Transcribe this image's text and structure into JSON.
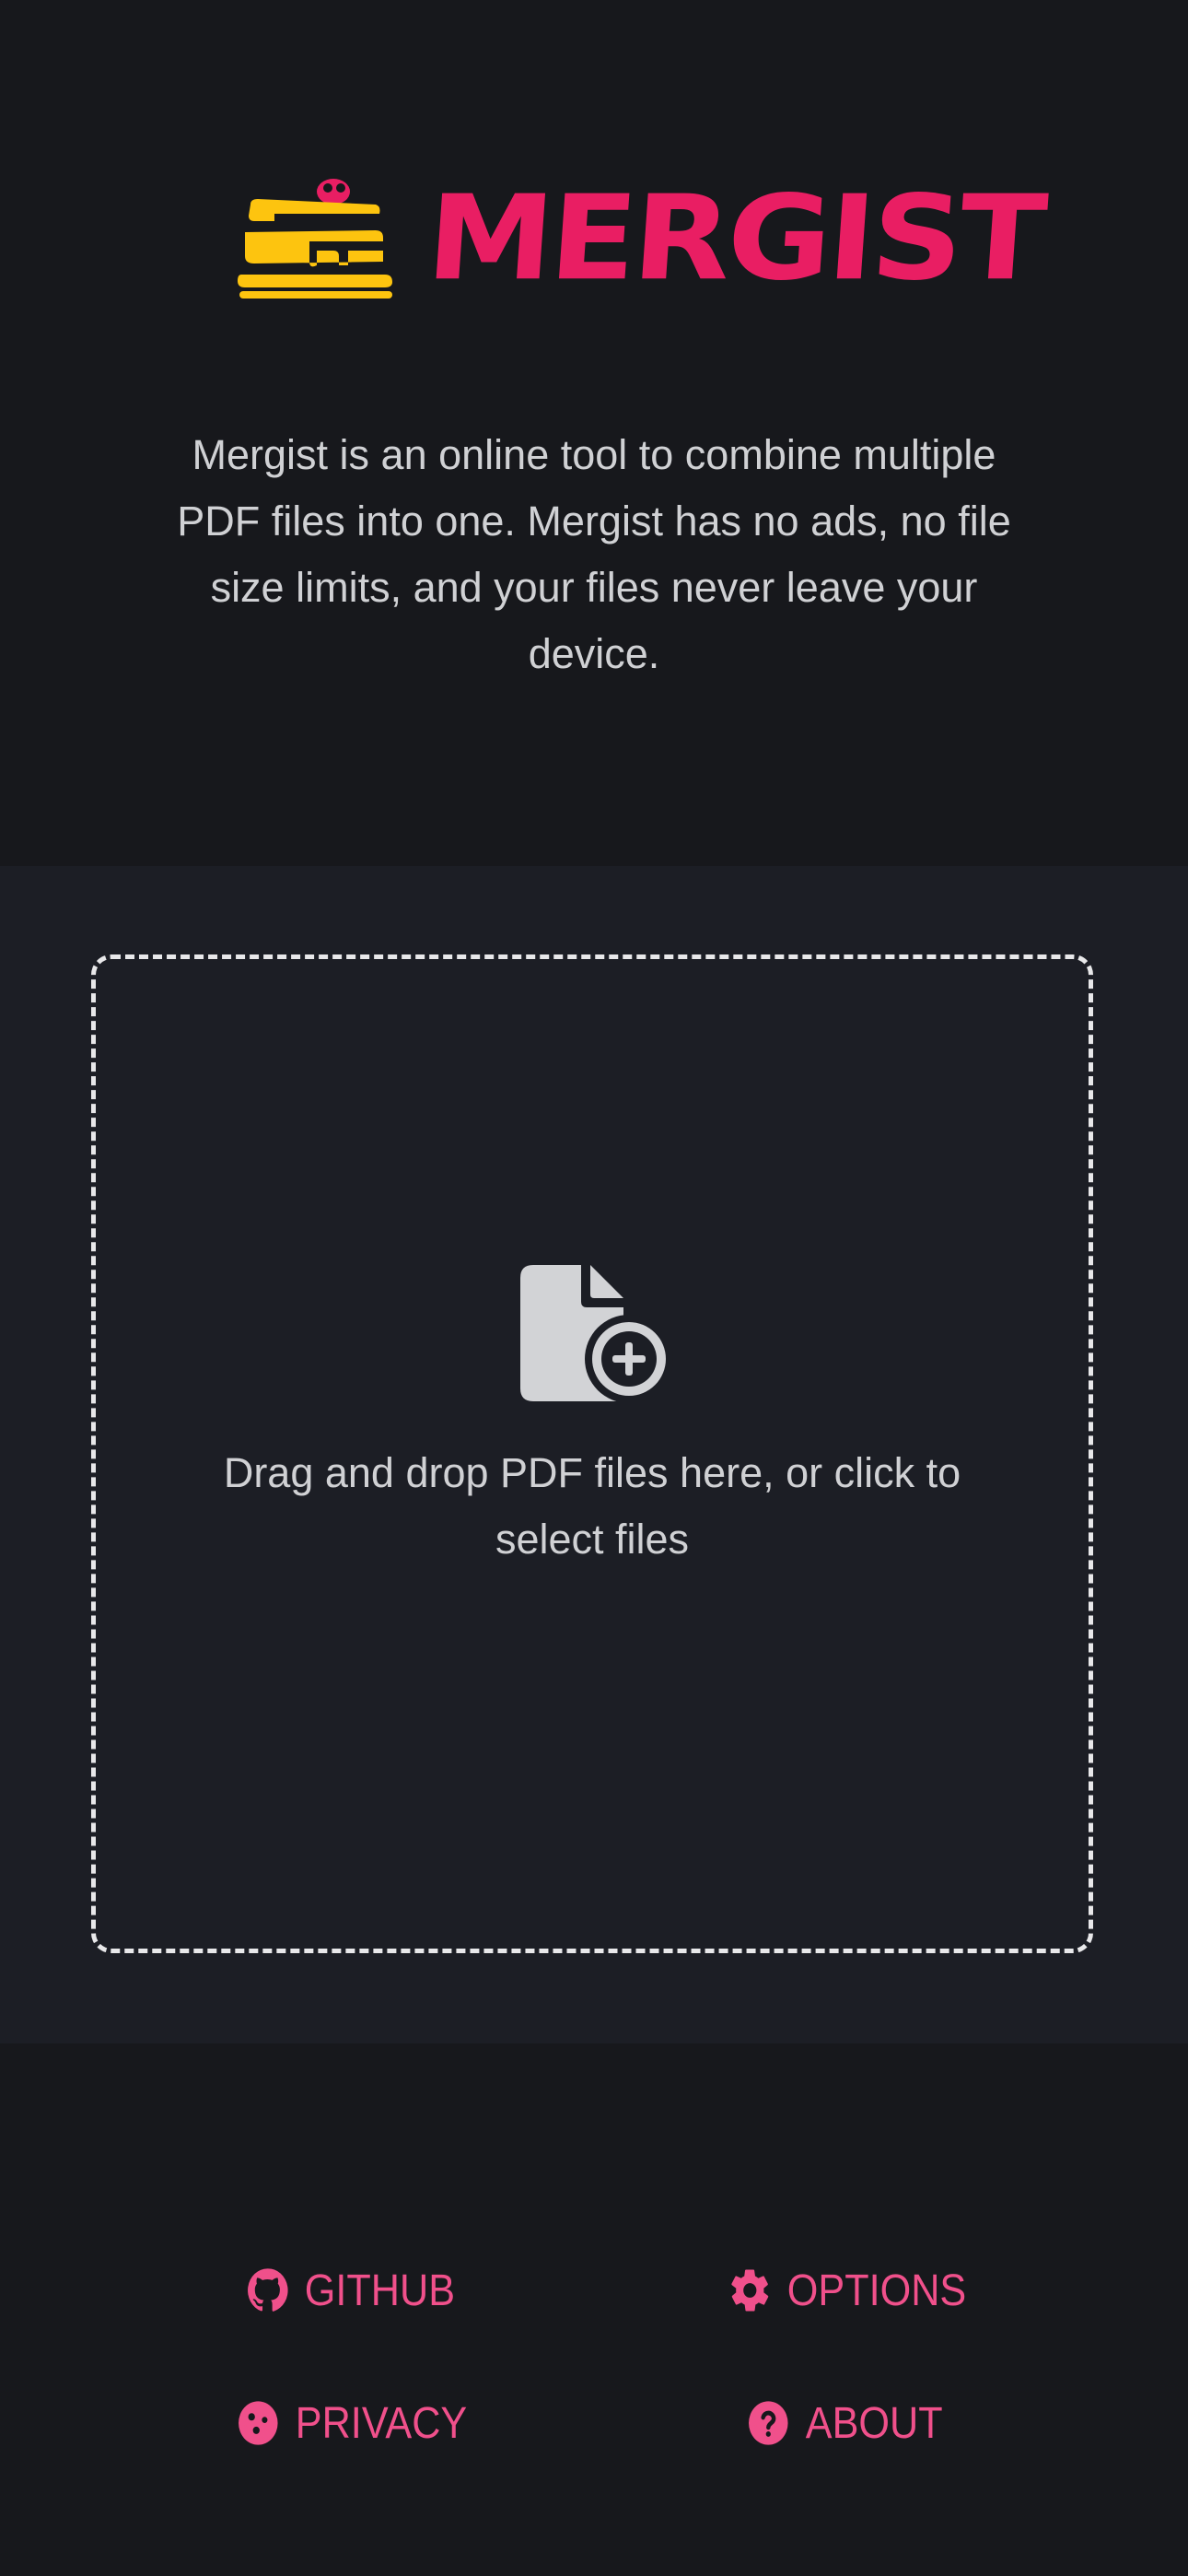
{
  "brand": {
    "name": "MERGIST",
    "accent_color": "#e91e63",
    "logo_icon": "layered-cake-logo-icon"
  },
  "intro": {
    "text": "Mergist is an online tool to combine multiple PDF files into one. Mergist has no ads, no file size limits, and your files never leave your device."
  },
  "dropzone": {
    "icon": "file-add-icon",
    "text": "Drag and drop PDF files here, or click to select files"
  },
  "footer": {
    "link_color": "#f0508b",
    "links": [
      {
        "label": "GITHUB",
        "icon": "github-icon"
      },
      {
        "label": "OPTIONS",
        "icon": "gear-icon"
      },
      {
        "label": "PRIVACY",
        "icon": "cookie-icon"
      },
      {
        "label": "ABOUT",
        "icon": "question-circle-icon"
      }
    ]
  }
}
